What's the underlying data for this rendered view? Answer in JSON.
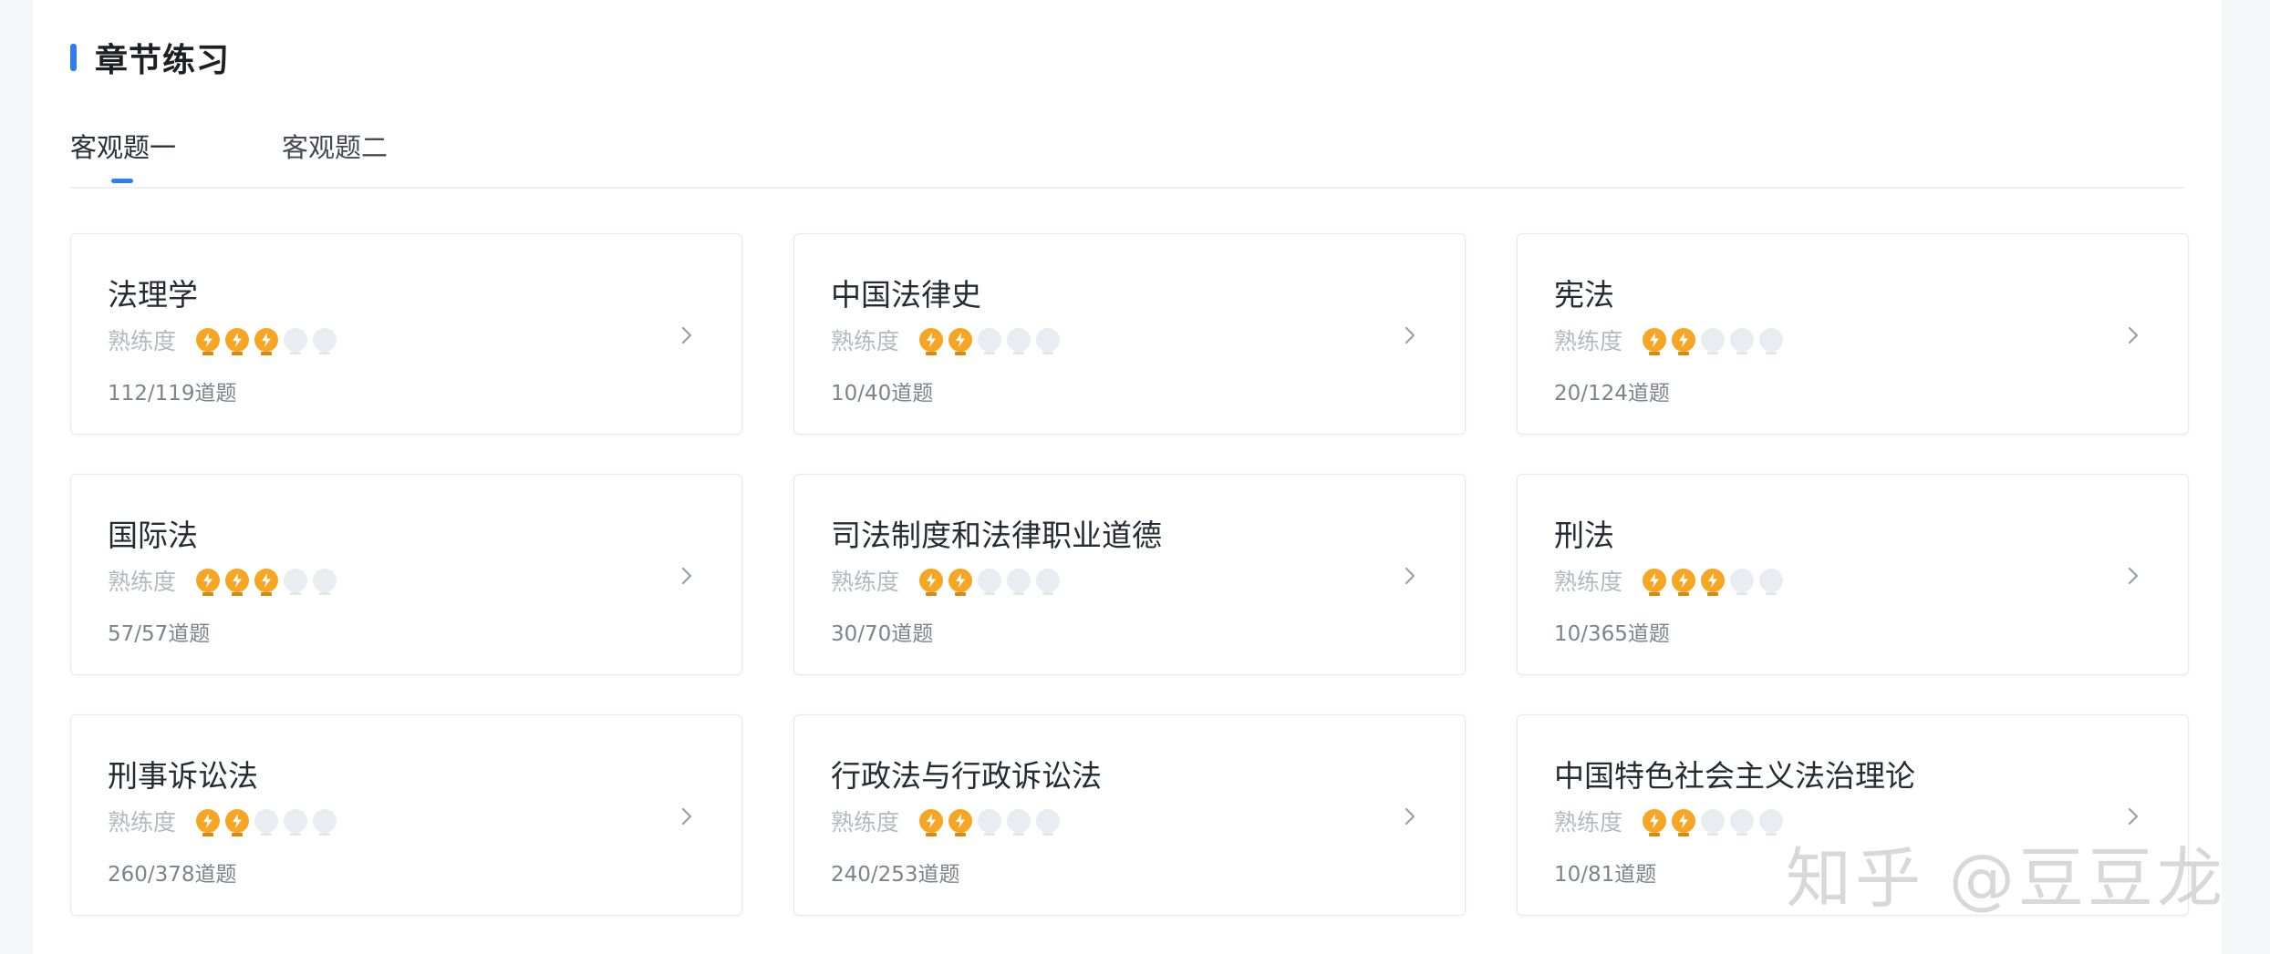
{
  "section": {
    "title": "章节练习"
  },
  "tabs": [
    {
      "label": "客观题一",
      "active": true
    },
    {
      "label": "客观题二",
      "active": false
    }
  ],
  "proficiency_label": "熟练度",
  "cards": [
    {
      "name": "法理学",
      "level": 3,
      "max_level": 5,
      "count": "112/119道题"
    },
    {
      "name": "中国法律史",
      "level": 2,
      "max_level": 5,
      "count": "10/40道题"
    },
    {
      "name": "宪法",
      "level": 2,
      "max_level": 5,
      "count": "20/124道题"
    },
    {
      "name": "国际法",
      "level": 3,
      "max_level": 5,
      "count": "57/57道题"
    },
    {
      "name": "司法制度和法律职业道德",
      "level": 2,
      "max_level": 5,
      "count": "30/70道题"
    },
    {
      "name": "刑法",
      "level": 3,
      "max_level": 5,
      "count": "10/365道题"
    },
    {
      "name": "刑事诉讼法",
      "level": 2,
      "max_level": 5,
      "count": "260/378道题"
    },
    {
      "name": "行政法与行政诉讼法",
      "level": 2,
      "max_level": 5,
      "count": "240/253道题"
    },
    {
      "name": "中国特色社会主义法治理论",
      "level": 2,
      "max_level": 5,
      "count": "10/81道题"
    }
  ],
  "icons": {
    "bulb_on": "lightbulb-lit-icon",
    "bulb_off": "lightbulb-unlit-icon",
    "chevron": "chevron-right-icon"
  },
  "colors": {
    "accent": "#2f7df6",
    "bulb_on": "#f6a623",
    "bulb_off": "#e9ecf1"
  },
  "watermark": "知乎 @豆豆龙"
}
